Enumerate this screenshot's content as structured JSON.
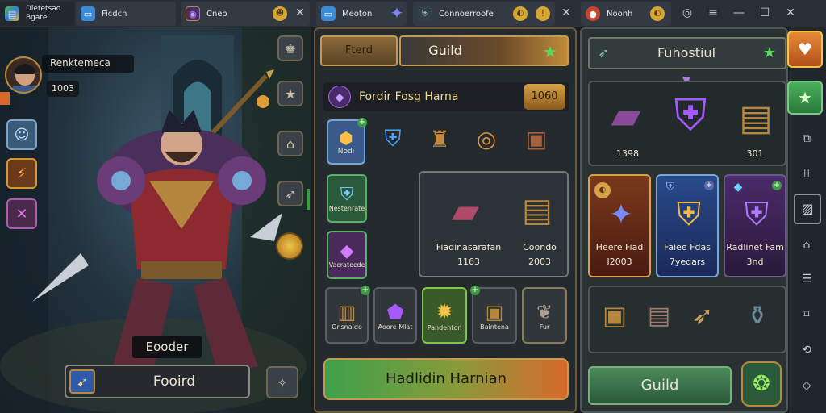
{
  "tabs": {
    "t1_title": "Dietetsao",
    "t1_sub": "Bgate",
    "t2": "Ficdch",
    "t3": "Cneo",
    "t4": "Meoton",
    "t5": "Connoerroofe",
    "t6": "Noonh"
  },
  "hero": {
    "name": "Renktemeca",
    "level": "1003",
    "caption": "Eooder",
    "action": "Fooird"
  },
  "guild_panel": {
    "tab_left": "Fterd",
    "title": "Guild",
    "section_title": "Fordir Fosg Harna",
    "section_count": "1060",
    "left_items": [
      "Nodi",
      "Nestenrate",
      "Vacratecde"
    ],
    "feature_big_name": "Fiadinasarafan",
    "feature_big_value": "1163",
    "feature_small_name": "Coondo",
    "feature_small_value": "2003",
    "bottom_items": [
      "Onsnaldo",
      "Aoore Mlat",
      "Pandenton",
      "Baintena",
      "Fur"
    ],
    "bottom_button": "Hadlidin Harnian"
  },
  "right_panel": {
    "title": "Fuhostiul",
    "top_left_value": "1398",
    "top_right_value": "301",
    "cards": [
      {
        "name": "Heere Fiad",
        "value": "I2003"
      },
      {
        "name": "Faiee Fdas",
        "value": "7yedars"
      },
      {
        "name": "Radlinet Fam",
        "value": "3nd"
      }
    ],
    "guild_button": "Guild"
  },
  "colors": {
    "gold": "#b78a3c",
    "green": "#3e9b41",
    "orange": "#d8692b",
    "purple": "#7a3fb0"
  }
}
